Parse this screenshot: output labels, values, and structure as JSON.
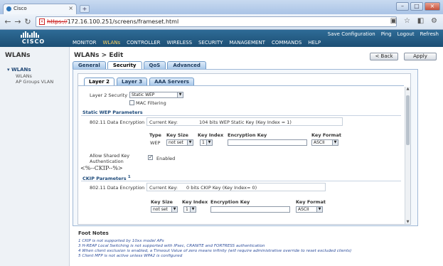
{
  "browser": {
    "tab_title": "Cisco",
    "url_proto": "https://",
    "url_rest": "172.16.100.251/screens/frameset.html"
  },
  "header": {
    "logo_text": "CISCO",
    "menu": [
      "MONITOR",
      "WLANs",
      "CONTROLLER",
      "WIRELESS",
      "SECURITY",
      "MANAGEMENT",
      "COMMANDS",
      "HELP"
    ],
    "active_menu": "WLANs",
    "util": [
      "Save Configuration",
      "Ping",
      "Logout",
      "Refresh"
    ]
  },
  "sidebar": {
    "title": "WLANs",
    "group": "WLANs",
    "items": [
      "WLANs",
      "AP Groups VLAN"
    ]
  },
  "page": {
    "title": "WLANs > Edit",
    "back_label": "< Back",
    "apply_label": "Apply",
    "tabs": [
      "General",
      "Security",
      "QoS",
      "Advanced"
    ],
    "active_tab": "Security",
    "subtabs": [
      "Layer 2",
      "Layer 3",
      "AAA Servers"
    ],
    "active_subtab": "Layer 2"
  },
  "layer2": {
    "security_label": "Layer 2 Security",
    "security_value": "Static WEP",
    "mac_filtering_label": "MAC Filtering",
    "mac_filtering_checked": false
  },
  "static_wep": {
    "section_title": "Static WEP Parameters",
    "encryption_label": "802.11 Data Encryption",
    "current_key_label": "Current Key:",
    "current_key_value": "104 bits WEP Static Key (Key Index = 1)",
    "col_type": "Type",
    "col_keysize": "Key Size",
    "col_keyindex": "Key Index",
    "col_enckey": "Encryption Key",
    "col_keyformat": "Key Format",
    "type_value": "WEP",
    "keysize_value": "not set",
    "keyindex_value": "1",
    "enckey_value": "",
    "keyformat_value": "ASCII",
    "shared_key_label_1": "Allow Shared Key",
    "shared_key_label_2": "Authentication",
    "shared_key_checked": true,
    "shared_key_enabled_label": "Enabled",
    "ckip_raw": "<%--CKIP--%>"
  },
  "ckip": {
    "section_title": "CKIP Parameters",
    "footnote_marker": "1",
    "encryption_label": "802.11 Data Encryption",
    "current_key_label": "Current Key:",
    "current_key_value": "0 bits CKIP Key (Key Index= 0)",
    "col_keysize": "Key Size",
    "col_keyindex": "Key Index",
    "col_enckey": "Encryption Key",
    "col_keyformat": "Key Format",
    "keysize_value": "not set",
    "keyindex_value": "1",
    "enckey_value": "",
    "keyformat_value": "ASCII"
  },
  "footnotes": {
    "title": "Foot Notes",
    "notes": [
      "1 CKIP is not supported by 10xx model APs",
      "3 H-REAP Local Switching is not supported with IPsec, CRANITE and FORTRESS authentication",
      "4 When client exclusion is enabled, a Timeout Value of zero means infinity (will require administrative override to reset excluded clients)",
      "5 Client MFP is not active unless WPA2 is configured"
    ]
  }
}
